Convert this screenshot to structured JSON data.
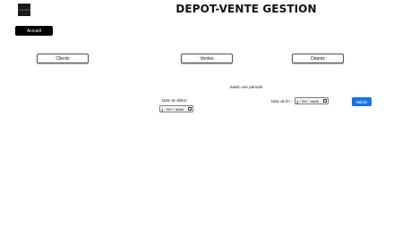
{
  "header": {
    "logo_text": "Lamaison",
    "title": "DEPOT-VENTE GESTION"
  },
  "home_button": {
    "label": "Accueil"
  },
  "nav": {
    "clients_label": "Clients",
    "ventes_label": "Ventes",
    "depots_label": "Dépots"
  },
  "period": {
    "prompt": "Saisir une période",
    "start_label": "Date de début :",
    "start_placeholder": "jj / mm / aaaa",
    "end_label": "Date de fin :",
    "end_placeholder": "jj / mm / aaaa",
    "submit_label": "Valider"
  }
}
